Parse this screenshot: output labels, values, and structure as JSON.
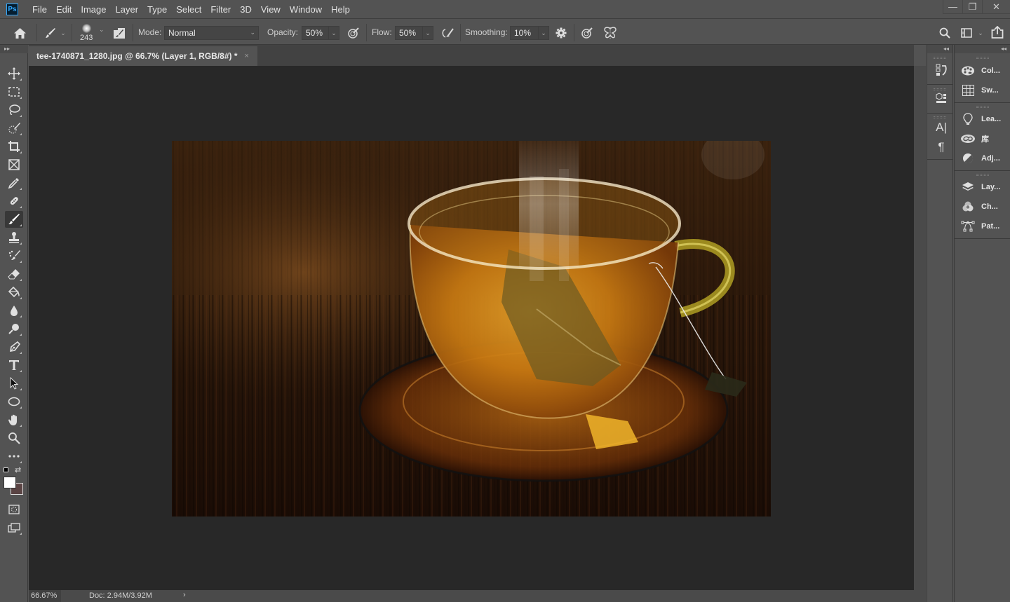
{
  "app": {
    "logo": "Ps"
  },
  "menu": [
    "File",
    "Edit",
    "Image",
    "Layer",
    "Type",
    "Select",
    "Filter",
    "3D",
    "View",
    "Window",
    "Help"
  ],
  "window_controls": {
    "minimize": "—",
    "restore": "❐",
    "close": "✕"
  },
  "options_bar": {
    "brush_size": "243",
    "mode_label": "Mode:",
    "mode_value": "Normal",
    "opacity_label": "Opacity:",
    "opacity_value": "50%",
    "flow_label": "Flow:",
    "flow_value": "50%",
    "smoothing_label": "Smoothing:",
    "smoothing_value": "10%"
  },
  "document": {
    "tab_title": "tee-1740871_1280.jpg @ 66.7% (Layer 1, RGB/8#) *",
    "close": "×"
  },
  "status": {
    "zoom": "66.67%",
    "doc_info": "Doc: 2.94M/3.92M",
    "arrow": "›"
  },
  "tools": [
    {
      "name": "move-tool",
      "active": false
    },
    {
      "name": "rectangular-marquee-tool",
      "active": false
    },
    {
      "name": "lasso-tool",
      "active": false
    },
    {
      "name": "quick-selection-tool",
      "active": false
    },
    {
      "name": "crop-tool",
      "active": false
    },
    {
      "name": "frame-tool",
      "active": false
    },
    {
      "name": "eyedropper-tool",
      "active": false
    },
    {
      "name": "healing-brush-tool",
      "active": false
    },
    {
      "name": "brush-tool",
      "active": true
    },
    {
      "name": "clone-stamp-tool",
      "active": false
    },
    {
      "name": "history-brush-tool",
      "active": false
    },
    {
      "name": "eraser-tool",
      "active": false
    },
    {
      "name": "paint-bucket-tool",
      "active": false
    },
    {
      "name": "blur-tool",
      "active": false
    },
    {
      "name": "dodge-tool",
      "active": false
    },
    {
      "name": "pen-tool",
      "active": false
    },
    {
      "name": "type-tool",
      "active": false
    },
    {
      "name": "path-selection-tool",
      "active": false
    },
    {
      "name": "ellipse-tool",
      "active": false
    },
    {
      "name": "hand-tool",
      "active": false
    },
    {
      "name": "zoom-tool",
      "active": false
    },
    {
      "name": "edit-toolbar",
      "active": false
    }
  ],
  "colors": {
    "foreground": "#ffffff",
    "background": "#5a4444",
    "accent": "#31a8ff"
  },
  "panels": {
    "dock2": [
      {
        "label": "Col...",
        "icon": "palette-icon"
      },
      {
        "label": "Sw...",
        "icon": "swatches-grid-icon"
      },
      {
        "label": "Lea...",
        "icon": "lightbulb-icon"
      },
      {
        "label": "库",
        "icon": "creative-cloud-icon"
      },
      {
        "label": "Adj...",
        "icon": "adjustments-icon"
      },
      {
        "label": "Lay...",
        "icon": "layers-icon"
      },
      {
        "label": "Ch...",
        "icon": "channels-icon"
      },
      {
        "label": "Pat...",
        "icon": "paths-icon"
      }
    ],
    "dock1": [
      {
        "icon": "history-icon"
      },
      {
        "icon": "properties-3d-icon"
      },
      {
        "icon": "character-icon",
        "glyph": "A|"
      },
      {
        "icon": "paragraph-icon",
        "glyph": "¶"
      }
    ]
  }
}
